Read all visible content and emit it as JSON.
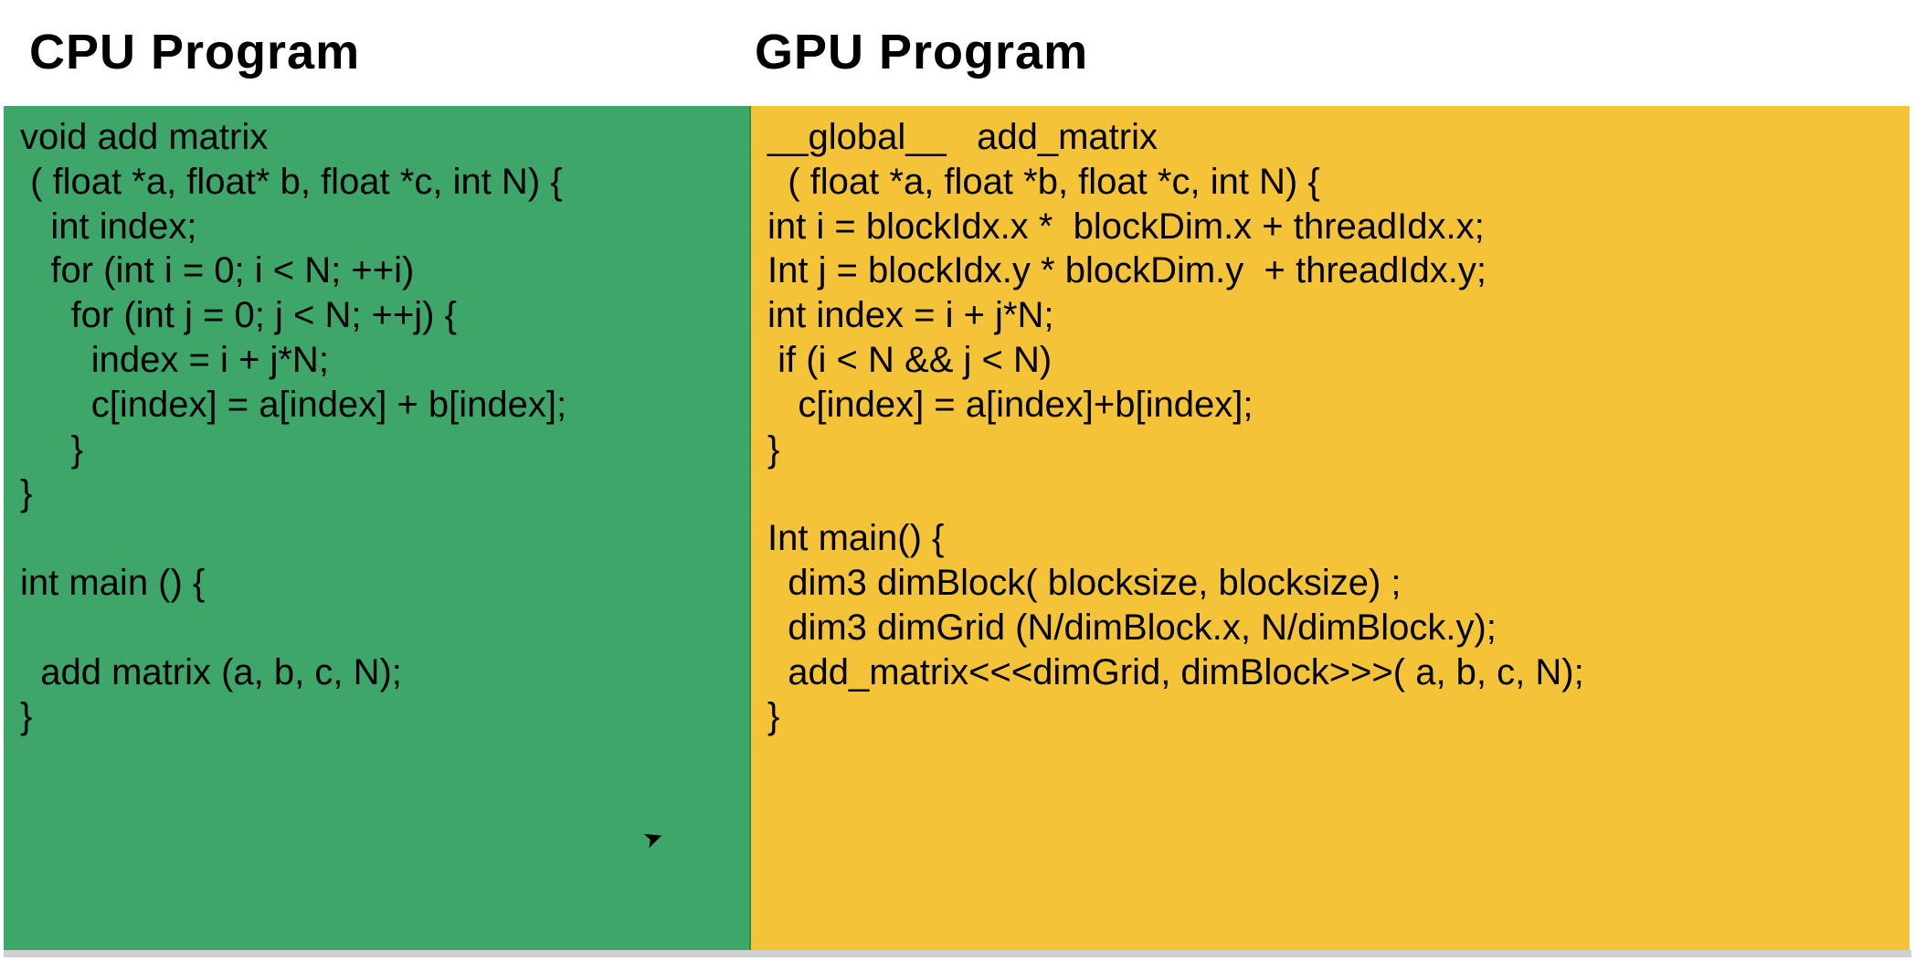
{
  "cpu": {
    "title": "CPU Program",
    "code": "void add matrix\n ( float *a, float* b, float *c, int N) {\n   int index;\n   for (int i = 0; i < N; ++i)\n     for (int j = 0; j < N; ++j) {\n       index = i + j*N;\n       c[index] = a[index] + b[index];\n     }\n}\n\nint main () {\n\n  add matrix (a, b, c, N);\n}"
  },
  "gpu": {
    "title": "GPU Program",
    "code": "__global__   add_matrix\n  ( float *a, float *b, float *c, int N) {\nint i = blockIdx.x *  blockDim.x + threadIdx.x;\nInt j = blockIdx.y * blockDim.y  + threadIdx.y;\nint index = i + j*N;\n if (i < N && j < N)\n   c[index] = a[index]+b[index];\n}\n\nInt main() {\n  dim3 dimBlock( blocksize, blocksize) ;\n  dim3 dimGrid (N/dimBlock.x, N/dimBlock.y);\n  add_matrix<<<dimGrid, dimBlock>>>( a, b, c, N);\n}"
  }
}
